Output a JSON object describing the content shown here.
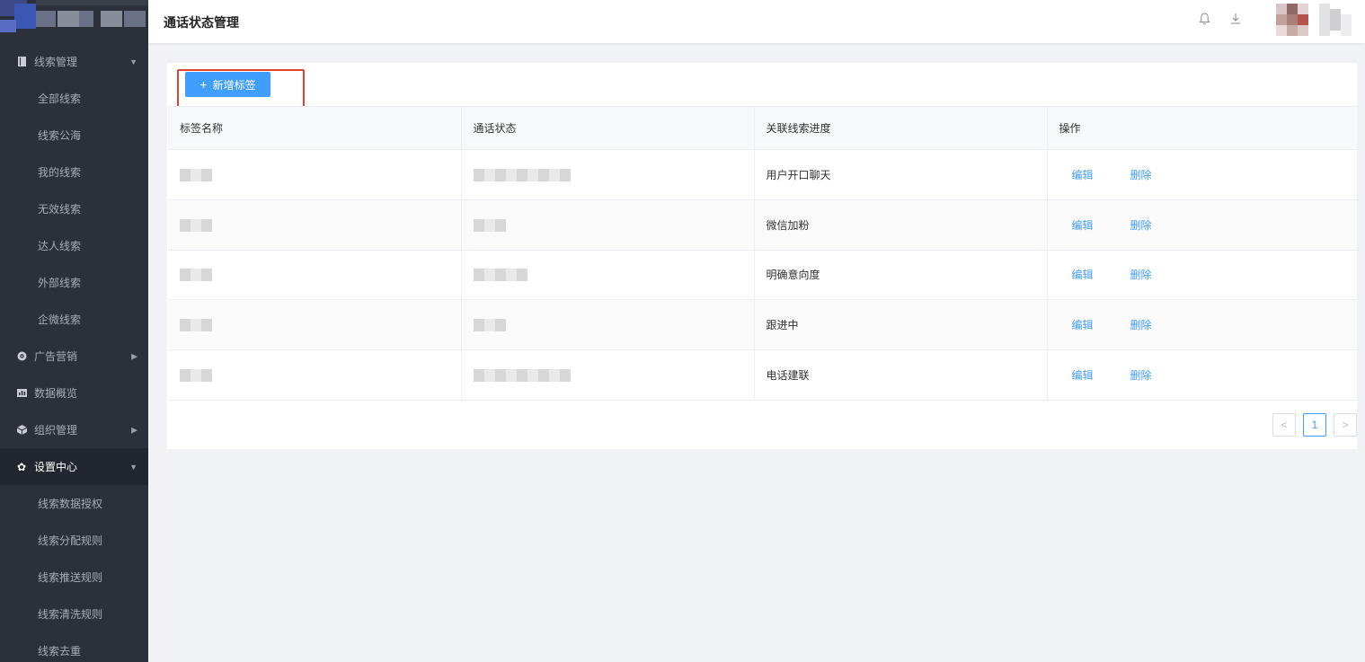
{
  "header": {
    "title": "通话状态管理"
  },
  "sidebar": {
    "groups": [
      {
        "label": "线索管理",
        "icon": "book-icon",
        "expanded": true,
        "items": [
          "全部线索",
          "线索公海",
          "我的线索",
          "无效线索",
          "达人线索",
          "外部线索",
          "企微线索"
        ]
      },
      {
        "label": "广告营销",
        "icon": "target-icon",
        "expanded": false
      },
      {
        "label": "数据概览",
        "icon": "chart-icon"
      },
      {
        "label": "组织管理",
        "icon": "cube-icon",
        "expanded": false
      },
      {
        "label": "设置中心",
        "icon": "gear-icon",
        "expanded": true,
        "active": true,
        "items": [
          "线索数据授权",
          "线索分配规则",
          "线索推送规则",
          "线索清洗规则",
          "线索去重"
        ]
      }
    ]
  },
  "toolbar": {
    "add_label": "新增标签"
  },
  "table": {
    "columns": [
      "标签名称",
      "通话状态",
      "关联线索进度",
      "操作"
    ],
    "rows": [
      {
        "progress": "用户开口聊天",
        "edit": "编辑",
        "delete": "删除"
      },
      {
        "progress": "微信加粉",
        "edit": "编辑",
        "delete": "删除"
      },
      {
        "progress": "明确意向度",
        "edit": "编辑",
        "delete": "删除"
      },
      {
        "progress": "跟进中",
        "edit": "编辑",
        "delete": "删除"
      },
      {
        "progress": "电话建联",
        "edit": "编辑",
        "delete": "删除"
      }
    ]
  },
  "pagination": {
    "prev": "<",
    "current": "1",
    "next": ">"
  },
  "colors": {
    "primary": "#409eff",
    "sidebar_bg": "#2b303b",
    "highlight": "#e0422f"
  }
}
